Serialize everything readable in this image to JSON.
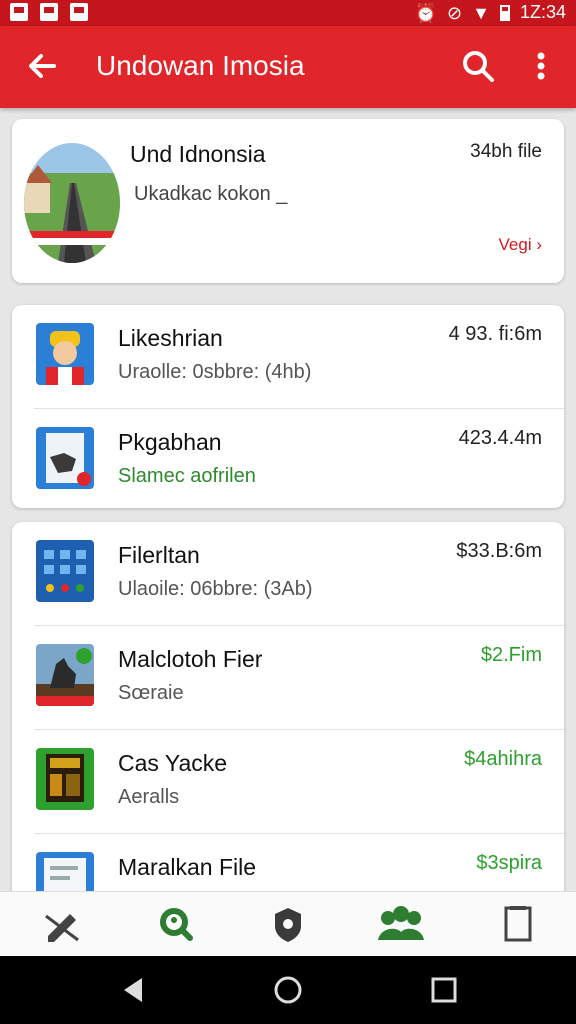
{
  "status_bar": {
    "time": "1Z:34"
  },
  "app_bar": {
    "title": "Undowan Imosia",
    "icons": [
      "back-arrow-icon",
      "search-icon",
      "more-vert-icon"
    ]
  },
  "featured": {
    "name": "Und Idnonsia",
    "subtitle": "Ukadkac kokon _",
    "size": "34bh file",
    "link": "Vegi ›"
  },
  "group1": [
    {
      "name": "Likeshrian",
      "sub": "Uraolle: 0sbbre: (4hb)",
      "size": "4 93. fi:6m",
      "icon": "avatar-app-icon"
    },
    {
      "name": "Pkgabhan",
      "sub": "Slamec aofrilen",
      "size": "423.4.4m",
      "icon": "document-app-icon"
    }
  ],
  "group2": [
    {
      "name": "Filerltan",
      "sub": "Ulaoile: 06bbre: (3Ab)",
      "size": "$33.B:6m",
      "icon": "grid-app-icon"
    },
    {
      "name": "Malclotoh Fier",
      "sub": "Sœraie",
      "size": "$2.Fim",
      "icon": "horse-app-icon"
    },
    {
      "name": "Cas Yacke",
      "sub": "Aeralls",
      "size": "$4ahihra",
      "icon": "game-app-icon"
    },
    {
      "name": "Maralkan File",
      "sub": "",
      "size": "$3spira",
      "icon": "file-app-icon"
    }
  ],
  "bottom_nav": [
    "pen-off-icon",
    "search-people-icon",
    "shield-icon",
    "community-icon",
    "document-icon"
  ],
  "colors": {
    "primary": "#e0252b",
    "status": "#c4161c",
    "green": "#2ea02e",
    "link": "#d11b22"
  }
}
